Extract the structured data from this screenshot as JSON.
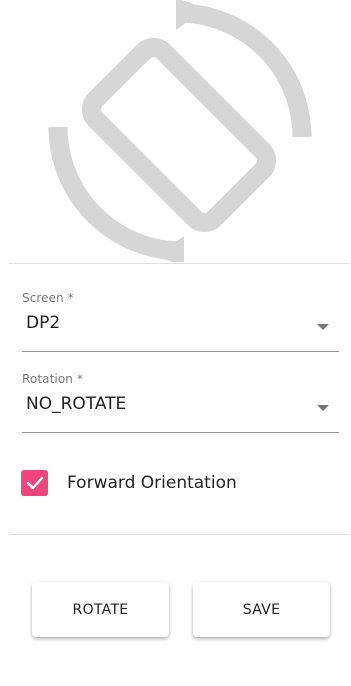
{
  "hero": {
    "icon": "screen-rotation-icon",
    "color": "#d6d6d6"
  },
  "form": {
    "screen": {
      "label": "Screen *",
      "value": "DP2"
    },
    "rotation": {
      "label": "Rotation *",
      "value": "NO_ROTATE"
    },
    "forward_orientation": {
      "label": "Forward Orientation",
      "checked": true,
      "color": "#f0457e"
    }
  },
  "actions": {
    "rotate_label": "ROTATE",
    "save_label": "SAVE"
  }
}
